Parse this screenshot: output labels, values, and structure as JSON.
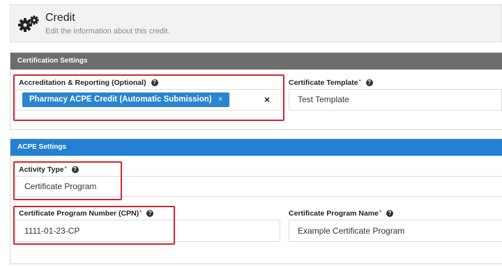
{
  "header": {
    "title": "Credit",
    "subtitle": "Edit the information about this credit.",
    "icon": "gears-icon"
  },
  "certification_settings": {
    "section_title": "Certification Settings",
    "accreditation_label": "Accreditation & Reporting (Optional)",
    "accreditation_tags": [
      "Pharmacy ACPE Credit (Automatic Submission)"
    ],
    "certificate_template_label": "Certificate Template",
    "certificate_template_value": "Test Template"
  },
  "acpe_settings": {
    "section_title": "ACPE Settings",
    "activity_type_label": "Activity Type",
    "activity_type_value": "Certificate Program",
    "cpn_label": "Certificate Program Number (CPN)",
    "cpn_value": "1111-01-23-CP",
    "cp_name_label": "Certificate Program Name",
    "cp_name_value": "Example Certificate Program"
  },
  "glyphs": {
    "required": "*",
    "help": "?",
    "remove_tag": "×",
    "clear": "×"
  },
  "colors": {
    "acpe_bar": "#2380d4",
    "cert_bar": "#6d6d6d",
    "tag": "#2a84cf",
    "highlight": "#d4232f"
  }
}
